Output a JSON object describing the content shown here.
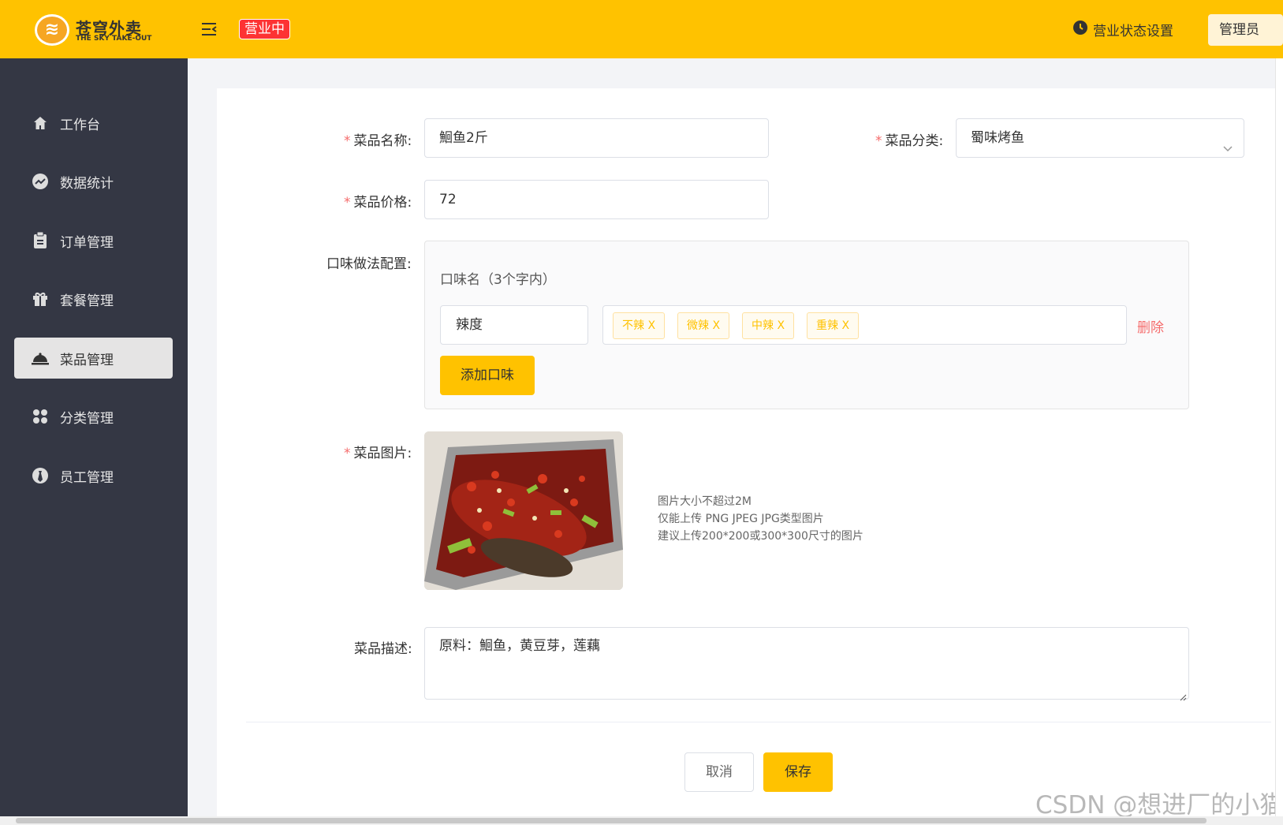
{
  "header": {
    "logo_cn": "苍穹外卖",
    "logo_en": "THE SKY TAKE-OUT",
    "status_badge": "营业中",
    "biz_setting": "营业状态设置",
    "admin": "管理员"
  },
  "sidebar": {
    "items": [
      {
        "label": "工作台",
        "icon": "home-icon"
      },
      {
        "label": "数据统计",
        "icon": "chart-icon"
      },
      {
        "label": "订单管理",
        "icon": "clipboard-icon"
      },
      {
        "label": "套餐管理",
        "icon": "gift-icon"
      },
      {
        "label": "菜品管理",
        "icon": "dish-cover-icon",
        "active": true
      },
      {
        "label": "分类管理",
        "icon": "grid-icon"
      },
      {
        "label": "员工管理",
        "icon": "employee-icon"
      }
    ]
  },
  "form": {
    "name_label": "菜品名称:",
    "name_value": "鮰鱼2斤",
    "category_label": "菜品分类:",
    "category_value": "蜀味烤鱼",
    "price_label": "菜品价格:",
    "price_value": "72",
    "flavor_label": "口味做法配置:",
    "flavor_title": "口味名（3个字内）",
    "flavor_name": "辣度",
    "flavor_tags": [
      "不辣 X",
      "微辣 X",
      "中辣 X",
      "重辣 X"
    ],
    "delete_label": "删除",
    "add_flavor_label": "添加口味",
    "image_label": "菜品图片:",
    "image_tips": [
      "图片大小不超过2M",
      "仅能上传 PNG JPEG JPG类型图片",
      "建议上传200*200或300*300尺寸的图片"
    ],
    "desc_label": "菜品描述:",
    "desc_value": "原料：鮰鱼，黄豆芽，莲藕",
    "required_mark": "*"
  },
  "actions": {
    "cancel": "取消",
    "save": "保存"
  },
  "watermark": "CSDN @想进厂的小猫",
  "colors": {
    "brand": "#ffc200",
    "sidebar": "#343744",
    "danger": "#f56c6c",
    "status": "#fd3333"
  }
}
